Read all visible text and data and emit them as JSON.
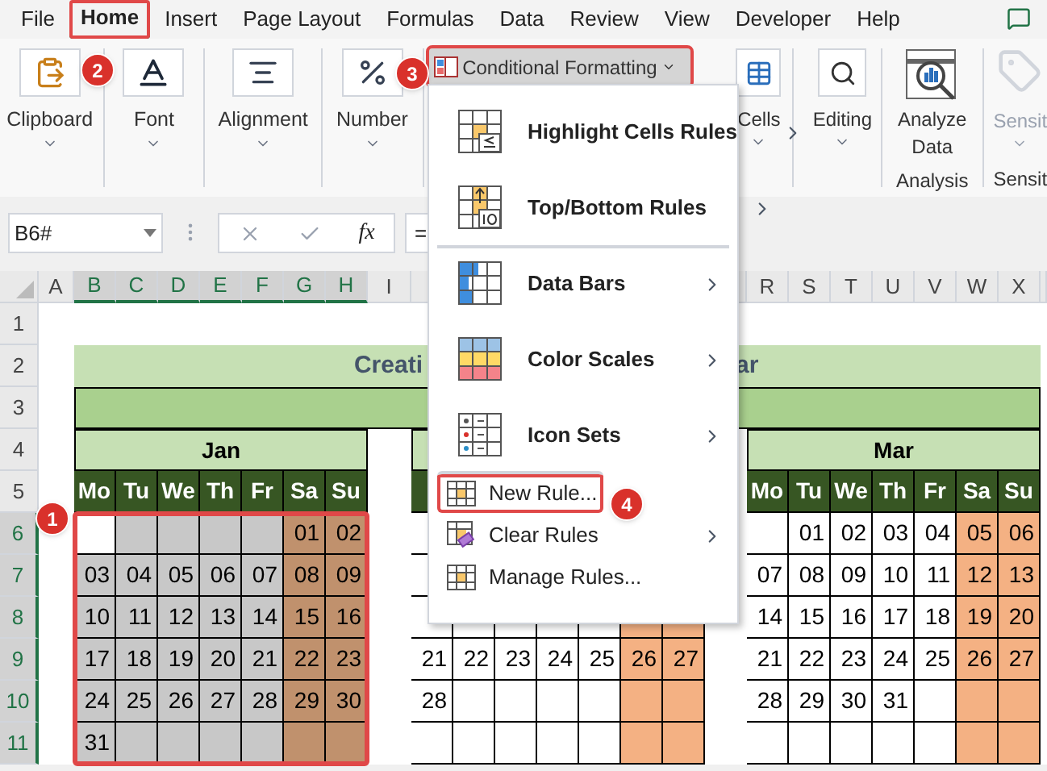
{
  "menu_tabs": [
    {
      "label": "File",
      "selected": false
    },
    {
      "label": "Home",
      "selected": true,
      "highlighted": true,
      "step": "2"
    },
    {
      "label": "Insert",
      "selected": false
    },
    {
      "label": "Page Layout",
      "selected": false
    },
    {
      "label": "Formulas",
      "selected": false
    },
    {
      "label": "Data",
      "selected": false
    },
    {
      "label": "Review",
      "selected": false
    },
    {
      "label": "View",
      "selected": false
    },
    {
      "label": "Developer",
      "selected": false
    },
    {
      "label": "Help",
      "selected": false
    }
  ],
  "ribbon": {
    "groups": [
      {
        "kind": "clipboard",
        "label": "Clipboard"
      },
      {
        "kind": "font",
        "label": "Font"
      },
      {
        "kind": "alignment",
        "label": "Alignment"
      },
      {
        "kind": "number",
        "label": "Number"
      }
    ],
    "conditional_formatting": {
      "label": "Conditional Formatting",
      "highlighted": true,
      "step": "3"
    },
    "cells": {
      "label": "Cells"
    },
    "editing": {
      "label": "Editing"
    },
    "analyze": {
      "label": "Analyze Data",
      "group": "Analysis"
    },
    "sensitivity": {
      "label": "Sensit",
      "group": "Sensit"
    }
  },
  "formula_bar": {
    "name_box": "B6#",
    "function_label": "fx",
    "formula": "="
  },
  "sheet": {
    "columns": [
      {
        "label": "A",
        "selected": false
      },
      {
        "label": "B",
        "selected": true
      },
      {
        "label": "C",
        "selected": true
      },
      {
        "label": "D",
        "selected": true
      },
      {
        "label": "E",
        "selected": true
      },
      {
        "label": "F",
        "selected": true
      },
      {
        "label": "G",
        "selected": true
      },
      {
        "label": "H",
        "selected": true
      },
      {
        "label": "I",
        "selected": false
      }
    ],
    "columns_right": [
      {
        "label": "R",
        "selected": false
      },
      {
        "label": "S",
        "selected": false
      },
      {
        "label": "T",
        "selected": false
      },
      {
        "label": "U",
        "selected": false
      },
      {
        "label": "V",
        "selected": false
      },
      {
        "label": "W",
        "selected": false
      },
      {
        "label": "X",
        "selected": false
      }
    ],
    "rows": [
      {
        "label": "1",
        "selected": false
      },
      {
        "label": "2",
        "selected": false
      },
      {
        "label": "3",
        "selected": false
      },
      {
        "label": "4",
        "selected": false
      },
      {
        "label": "5",
        "selected": false
      },
      {
        "label": "6",
        "selected": true
      },
      {
        "label": "7",
        "selected": true
      },
      {
        "label": "8",
        "selected": true
      },
      {
        "label": "9",
        "selected": true
      },
      {
        "label": "10",
        "selected": true
      },
      {
        "label": "11",
        "selected": true
      }
    ],
    "title_left": "Creati",
    "title_right": "ar"
  },
  "calendar": {
    "months": [
      {
        "name": "Jan",
        "selected": true,
        "step": "1",
        "weekdays": [
          "Mo",
          "Tu",
          "We",
          "Th",
          "Fr",
          "Sa",
          "Su"
        ],
        "weeks": [
          [
            "01",
            "02"
          ],
          [
            "03",
            "04",
            "05",
            "06",
            "07",
            "08",
            "09"
          ],
          [
            "10",
            "11",
            "12",
            "13",
            "14",
            "15",
            "16"
          ],
          [
            "17",
            "18",
            "19",
            "20",
            "21",
            "22",
            "23"
          ],
          [
            "24",
            "25",
            "26",
            "27",
            "28",
            "29",
            "30"
          ],
          [
            "31"
          ]
        ]
      },
      {
        "selected": false,
        "weeks_below_menu": [
          [
            "21",
            "22",
            "23",
            "24",
            "25",
            "26",
            "27"
          ],
          [
            "28"
          ]
        ]
      },
      {
        "name": "Mar",
        "selected": false,
        "weekdays": [
          "Mo",
          "Tu",
          "We",
          "Th",
          "Fr",
          "Sa",
          "Su"
        ],
        "weeks": [
          [
            "01",
            "02",
            "03",
            "04",
            "05",
            "06"
          ],
          [
            "07",
            "08",
            "09",
            "10",
            "11",
            "12",
            "13"
          ],
          [
            "14",
            "15",
            "16",
            "17",
            "18",
            "19",
            "20"
          ],
          [
            "21",
            "22",
            "23",
            "24",
            "25",
            "26",
            "27"
          ],
          [
            "28",
            "29",
            "30",
            "31"
          ]
        ]
      }
    ]
  },
  "dropdown_menu": {
    "items": [
      {
        "kind": "highlight_cells",
        "label": "Highlight Cells Rules",
        "submenu": true,
        "separator_before": false,
        "highlighted": false
      },
      {
        "kind": "top_bottom",
        "label": "Top/Bottom Rules",
        "submenu": true,
        "separator_before": false,
        "highlighted": false
      },
      {
        "kind": "data_bars",
        "label": "Data Bars",
        "submenu": true,
        "separator_before": true,
        "highlighted": false
      },
      {
        "kind": "color_scales",
        "label": "Color Scales",
        "submenu": true,
        "separator_before": false,
        "highlighted": false
      },
      {
        "kind": "icon_sets",
        "label": "Icon Sets",
        "submenu": true,
        "separator_before": false,
        "highlighted": false
      },
      {
        "kind": "new_rule",
        "label": "New Rule...",
        "submenu": false,
        "separator_before": true,
        "highlighted": true,
        "step": "4"
      },
      {
        "kind": "clear_rules",
        "label": "Clear Rules",
        "submenu": true,
        "separator_before": false,
        "highlighted": false
      },
      {
        "kind": "manage_rules",
        "label": "Manage Rules...",
        "submenu": false,
        "separator_before": false,
        "highlighted": false
      }
    ]
  }
}
